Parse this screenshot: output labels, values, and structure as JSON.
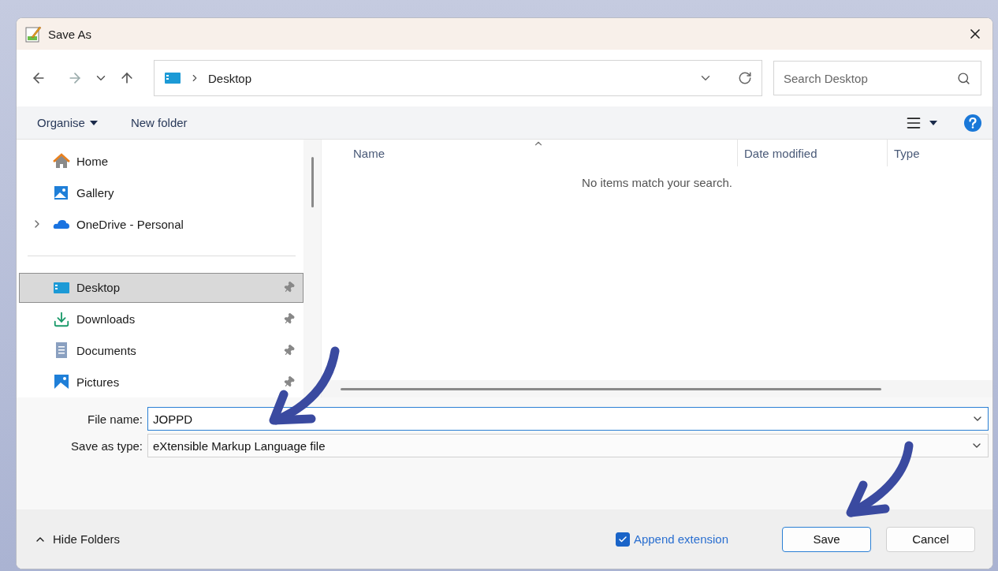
{
  "window": {
    "title": "Save As"
  },
  "navigation": {
    "path": "Desktop",
    "search_placeholder": "Search Desktop"
  },
  "toolbar": {
    "organise": "Organise",
    "new_folder": "New folder"
  },
  "sidebar": {
    "sections": [
      {
        "items": [
          {
            "label": "Home",
            "selected": false,
            "pinned": false,
            "expandable": false
          },
          {
            "label": "Gallery",
            "selected": false,
            "pinned": false,
            "expandable": false
          },
          {
            "label": "OneDrive - Personal",
            "selected": false,
            "pinned": false,
            "expandable": true
          }
        ]
      },
      {
        "items": [
          {
            "label": "Desktop",
            "selected": true,
            "pinned": true,
            "expandable": false
          },
          {
            "label": "Downloads",
            "selected": false,
            "pinned": true,
            "expandable": false
          },
          {
            "label": "Documents",
            "selected": false,
            "pinned": true,
            "expandable": false
          },
          {
            "label": "Pictures",
            "selected": false,
            "pinned": true,
            "expandable": false
          }
        ]
      }
    ]
  },
  "file_list": {
    "columns": [
      "Name",
      "Date modified",
      "Type"
    ],
    "empty_message": "No items match your search."
  },
  "fields": {
    "file_name_label": "File name:",
    "file_name": "JOPPD",
    "type_label": "Save as type:",
    "type": "eXtensible Markup Language file"
  },
  "footer": {
    "hide_folders": "Hide Folders",
    "append_extension": {
      "label": "Append extension",
      "checked": true
    },
    "buttons": [
      {
        "label": "Save",
        "default": true
      },
      {
        "label": "Cancel",
        "default": false
      }
    ]
  }
}
